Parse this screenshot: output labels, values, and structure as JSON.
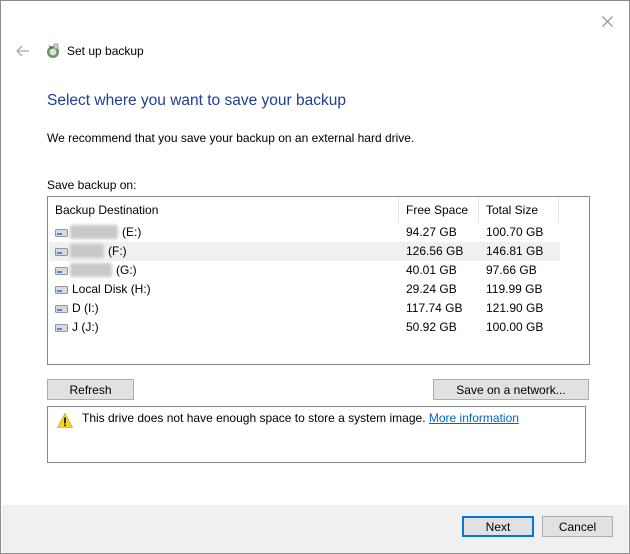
{
  "window": {
    "title": "Set up backup",
    "icons": {
      "close": "close-icon",
      "back": "back-arrow-icon",
      "app": "backup-icon"
    }
  },
  "page": {
    "heading": "Select where you want to save your backup",
    "subtext": "We recommend that you save your backup on an external hard drive.",
    "save_label": "Save backup on:"
  },
  "table": {
    "columns": [
      "Backup Destination",
      "Free Space",
      "Total Size"
    ],
    "rows": [
      {
        "name": "(E:)",
        "free": "94.27 GB",
        "total": "100.70 GB",
        "redacted": true,
        "selected": false
      },
      {
        "name": "(F:)",
        "free": "126.56 GB",
        "total": "146.81 GB",
        "redacted": true,
        "selected": true
      },
      {
        "name": "(G:)",
        "free": "40.01 GB",
        "total": "97.66 GB",
        "redacted": true,
        "selected": false
      },
      {
        "name": "Local Disk (H:)",
        "free": "29.24 GB",
        "total": "119.99 GB",
        "redacted": false,
        "selected": false
      },
      {
        "name": "D (I:)",
        "free": "117.74 GB",
        "total": "121.90 GB",
        "redacted": false,
        "selected": false
      },
      {
        "name": "J (J:)",
        "free": "50.92 GB",
        "total": "100.00 GB",
        "redacted": false,
        "selected": false
      }
    ]
  },
  "buttons": {
    "refresh": "Refresh",
    "save_network": "Save on a network...",
    "next": "Next",
    "cancel": "Cancel"
  },
  "warning": {
    "icon": "warning-icon",
    "text": "This drive does not have enough space to store a system image.",
    "link": "More information"
  },
  "colors": {
    "heading": "#1e3f8f",
    "link": "#0066cc",
    "primary_border": "#0078d7",
    "footer_bg": "#f0f0f0"
  }
}
